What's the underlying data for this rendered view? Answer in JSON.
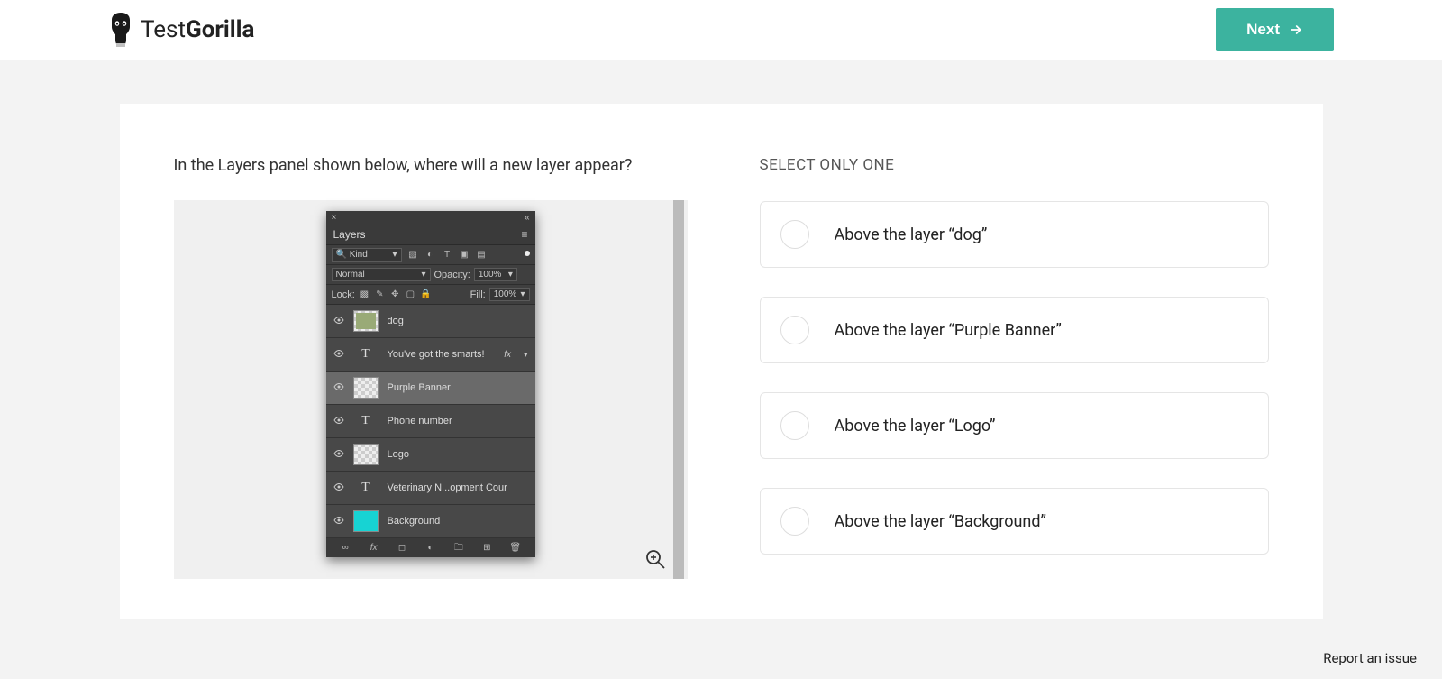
{
  "brand": {
    "name_light": "Test",
    "name_bold": "Gorilla"
  },
  "header": {
    "next_label": "Next"
  },
  "question": {
    "text": "In the Layers panel shown below, where will a new layer appear?"
  },
  "answers": {
    "instruction": "SELECT ONLY ONE",
    "options": [
      {
        "label": "Above the layer “dog”"
      },
      {
        "label": "Above the layer “Purple Banner”"
      },
      {
        "label": "Above the layer “Logo”"
      },
      {
        "label": "Above the layer “Background”"
      }
    ]
  },
  "layers_panel": {
    "title": "Layers",
    "filter_kind": "Kind",
    "blend_mode": "Normal",
    "opacity_label": "Opacity:",
    "opacity_value": "100%",
    "lock_label": "Lock:",
    "fill_label": "Fill:",
    "fill_value": "100%",
    "layers": [
      {
        "name": "dog",
        "type": "image",
        "selected": false,
        "fx": false
      },
      {
        "name": "You've got the smarts!",
        "type": "text",
        "selected": false,
        "fx": true
      },
      {
        "name": "Purple Banner",
        "type": "checker",
        "selected": true,
        "fx": false
      },
      {
        "name": "Phone number",
        "type": "text",
        "selected": false,
        "fx": false
      },
      {
        "name": "Logo",
        "type": "logo",
        "selected": false,
        "fx": false
      },
      {
        "name": "Veterinary N...opment Cour",
        "type": "text",
        "selected": false,
        "fx": false
      },
      {
        "name": "Background",
        "type": "cyan",
        "selected": false,
        "fx": false
      }
    ]
  },
  "footer": {
    "report_label": "Report an issue"
  }
}
